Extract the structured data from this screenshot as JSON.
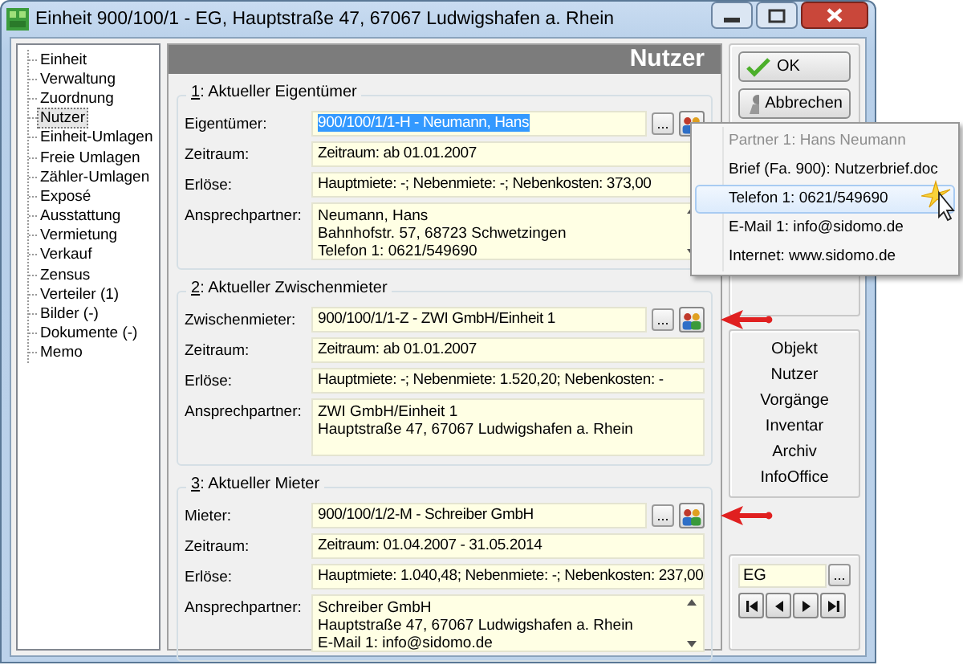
{
  "window": {
    "title": "Einheit 900/100/1 - EG, Hauptstraße 47, 67067 Ludwigshafen a. Rhein"
  },
  "tree": {
    "items": [
      {
        "label": "Einheit",
        "selected": false
      },
      {
        "label": "Verwaltung",
        "selected": false
      },
      {
        "label": "Zuordnung",
        "selected": false
      },
      {
        "label": "Nutzer",
        "selected": true
      },
      {
        "label": "Einheit-Umlagen",
        "selected": false
      },
      {
        "label": "Freie Umlagen",
        "selected": false
      },
      {
        "label": "Zähler-Umlagen",
        "selected": false
      },
      {
        "label": "Exposé",
        "selected": false
      },
      {
        "label": "Ausstattung",
        "selected": false
      },
      {
        "label": "Vermietung",
        "selected": false
      },
      {
        "label": "Verkauf",
        "selected": false
      },
      {
        "label": "Zensus",
        "selected": false
      },
      {
        "label": "Verteiler (1)",
        "selected": false
      },
      {
        "label": "Bilder (-)",
        "selected": false
      },
      {
        "label": "Dokumente (-)",
        "selected": false
      },
      {
        "label": "Memo",
        "selected": false
      }
    ]
  },
  "header": "Nutzer",
  "groups": [
    {
      "key": "1",
      "title": ": Aktueller Eigentümer",
      "rows": [
        {
          "kind": "lookup",
          "label": "Eigentümer:",
          "value": "900/100/1/1-H - Neumann, Hans",
          "selected": true,
          "browse": "...",
          "arrow": false
        },
        {
          "kind": "text",
          "label": "Zeitraum:",
          "value": "Zeitraum: ab 01.01.2007"
        },
        {
          "kind": "text",
          "label": "Erlöse:",
          "value": "Hauptmiete: -;  Nebenmiete: -;  Nebenkosten: 373,00"
        },
        {
          "kind": "memo",
          "label": "Ansprechpartner:",
          "lines": [
            "Neumann, Hans",
            "Bahnhofstr. 57, 68723 Schwetzingen",
            "Telefon 1: 0621/549690"
          ],
          "scrollbar": true
        }
      ]
    },
    {
      "key": "2",
      "title": ": Aktueller Zwischenmieter",
      "rows": [
        {
          "kind": "lookup",
          "label": "Zwischenmieter:",
          "value": "900/100/1/1-Z - ZWI GmbH/Einheit 1",
          "selected": false,
          "browse": "...",
          "arrow": true
        },
        {
          "kind": "text",
          "label": "Zeitraum:",
          "value": "Zeitraum: ab 01.01.2007"
        },
        {
          "kind": "text",
          "label": "Erlöse:",
          "value": "Hauptmiete: -;  Nebenmiete: 1.520,20;  Nebenkosten: -"
        },
        {
          "kind": "memo",
          "label": "Ansprechpartner:",
          "lines": [
            "ZWI GmbH/Einheit 1",
            "Hauptstraße 47, 67067 Ludwigshafen a. Rhein"
          ],
          "scrollbar": false
        }
      ]
    },
    {
      "key": "3",
      "title": ": Aktueller Mieter",
      "rows": [
        {
          "kind": "lookup",
          "label": "Mieter:",
          "value": "900/100/1/2-M - Schreiber  GmbH",
          "selected": false,
          "browse": "...",
          "arrow": true
        },
        {
          "kind": "text",
          "label": "Zeitraum:",
          "value": "Zeitraum: 01.04.2007 - 31.05.2014"
        },
        {
          "kind": "text",
          "label": "Erlöse:",
          "value": "Hauptmiete: 1.040,48;  Nebenmiete: -;  Nebenkosten: 237,00"
        },
        {
          "kind": "memo",
          "label": "Ansprechpartner:",
          "lines": [
            "Schreiber GmbH",
            "Hauptstraße 47, 67067 Ludwigshafen a. Rhein",
            "E-Mail 1: info@sidomo.de"
          ],
          "scrollbar": true
        }
      ]
    }
  ],
  "actions": [
    {
      "kind": "ok",
      "label": "OK"
    },
    {
      "kind": "cancel",
      "label": "Abbrechen"
    }
  ],
  "nav_links": [
    "Objekt",
    "Nutzer",
    "Vorgänge",
    "Inventar",
    "Archiv",
    "InfoOffice"
  ],
  "record": {
    "value": "EG",
    "browse": "..."
  },
  "popup": {
    "items": [
      {
        "label": "Partner 1: Hans Neumann",
        "disabled": true,
        "selected": false
      },
      {
        "label": "Brief (Fa. 900): Nutzerbrief.doc",
        "disabled": false,
        "selected": false
      },
      {
        "label": "Telefon 1: 0621/549690",
        "disabled": false,
        "selected": true
      },
      {
        "label": "E-Mail 1: info@sidomo.de",
        "disabled": false,
        "selected": false
      },
      {
        "label": "Internet: www.sidomo.de",
        "disabled": false,
        "selected": false
      }
    ]
  }
}
